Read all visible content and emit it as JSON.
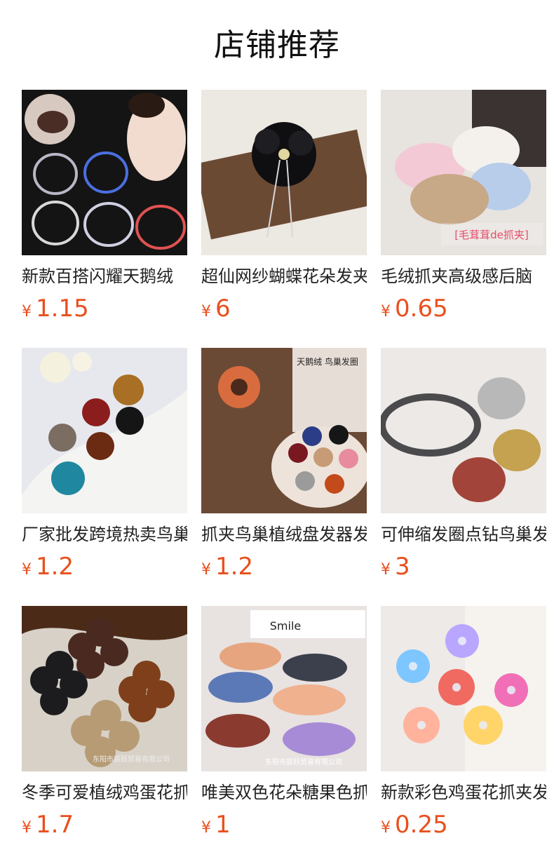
{
  "section": {
    "title": "店铺推荐"
  },
  "products": [
    {
      "name": "新款百搭闪耀天鹅绒",
      "currency": "¥",
      "price": "1.15"
    },
    {
      "name": "超仙网纱蝴蝶花朵发夹",
      "currency": "¥",
      "price": "6"
    },
    {
      "name": "毛绒抓夹高级感后脑",
      "currency": "¥",
      "price": "0.65",
      "image_text": "[毛茸茸de抓夹]"
    },
    {
      "name": "厂家批发跨境热卖鸟巢",
      "currency": "¥",
      "price": "1.2"
    },
    {
      "name": "抓夹鸟巢植绒盘发器发",
      "currency": "¥",
      "price": "1.2",
      "image_text": "天鹅绒 鸟巢发圈"
    },
    {
      "name": "可伸缩发圈点钻鸟巢发",
      "currency": "¥",
      "price": "3"
    },
    {
      "name": "冬季可爱植绒鸡蛋花抓",
      "currency": "¥",
      "price": "1.7",
      "image_text": "东阳市辰跃贸易有限公司"
    },
    {
      "name": "唯美双色花朵糖果色抓",
      "currency": "¥",
      "price": "1",
      "image_text": "东阳市辰跃贸易有限公司"
    },
    {
      "name": "新款彩色鸡蛋花抓夹发",
      "currency": "¥",
      "price": "0.25"
    }
  ],
  "colors": {
    "price": "#e8501e"
  }
}
